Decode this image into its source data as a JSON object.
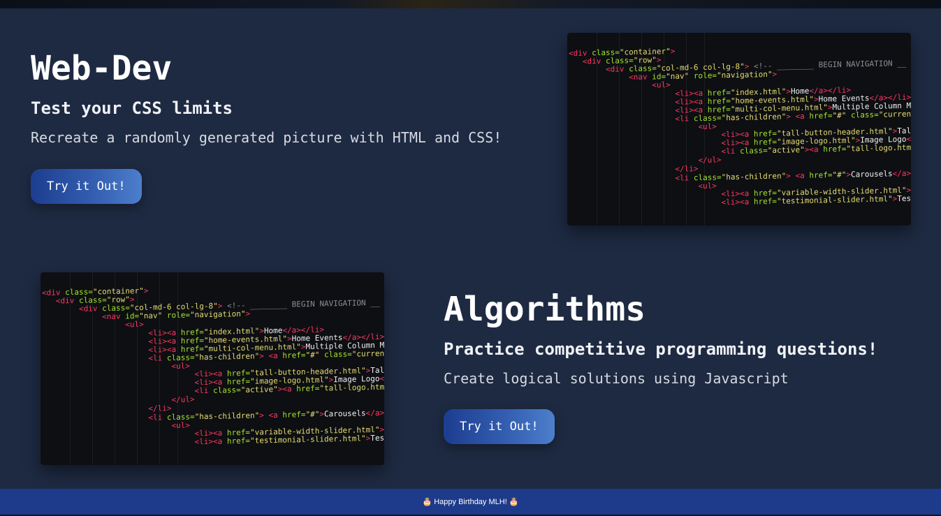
{
  "webdev": {
    "title": "Web-Dev",
    "subtitle": "Test your CSS limits",
    "description": "Recreate a randomly generated picture with HTML and CSS!",
    "button_label": "Try it Out!"
  },
  "algorithms": {
    "title": "Algorithms",
    "subtitle": "Practice competitive programming questions!",
    "description": "Create logical solutions using Javascript",
    "button_label": "Try it Out!"
  },
  "footer": {
    "text": "🎂 Happy Birthday MLH! 🎂"
  },
  "colors": {
    "background": "#1e2a42",
    "footer": "#1e3a8a",
    "button_start": "#1d3d8f",
    "button_end": "#4c7fcc"
  }
}
